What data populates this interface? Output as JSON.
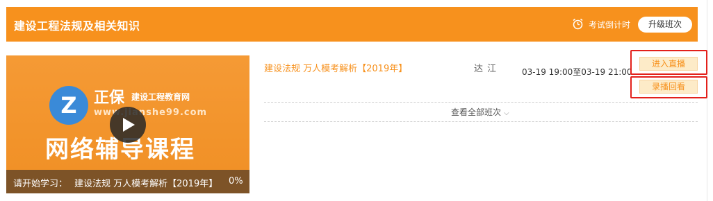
{
  "header": {
    "title": "建设工程法规及相关知识",
    "countdown_label": "考试倒计时",
    "upgrade_label": "升级班次",
    "accent_color": "#f7911d"
  },
  "thumbnail": {
    "brand_main": "正保",
    "brand_sub": "建设工程教育网",
    "brand_url": "www.jianshe99.com",
    "logo_letter": "Z",
    "course_text": "网络辅导课程",
    "caption_prefix": "请开始学习：",
    "caption_course": "建设法规 万人模考解析【2019年】",
    "caption_progress": "0%"
  },
  "lesson": {
    "title": "建设法规 万人模考解析【2019年】",
    "teacher": "达江",
    "time": "03-19 19:00至03-19 21:00",
    "live_label": "进入直播",
    "replay_label": "录播回看"
  },
  "footer": {
    "view_all_label": "查看全部班次",
    "chevron": "⌵"
  },
  "icons": {
    "clock": "alarm-clock-icon",
    "play": "play-icon",
    "chevron": "chevron-down-icon"
  }
}
